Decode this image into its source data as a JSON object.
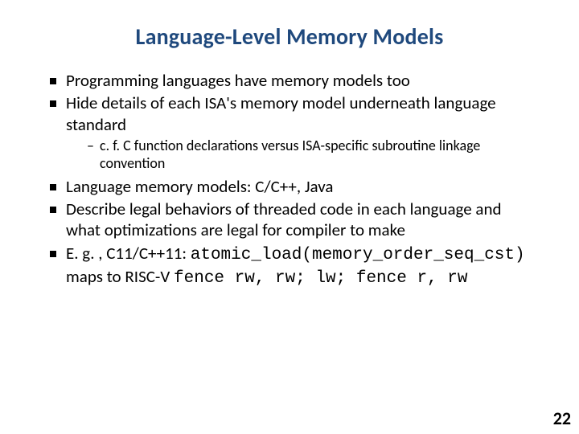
{
  "title": "Language-Level Memory Models",
  "bullets": {
    "b1": "Programming languages have memory models too",
    "b2": "Hide details of each ISA's memory model underneath language standard",
    "b2_sub1": "c. f. C function declarations versus ISA-specific subroutine linkage convention",
    "b3": "Language memory models: C/C++, Java",
    "b4": "Describe legal behaviors of threaded code in each language and what optimizations are legal for compiler to make",
    "b5_lead": "E. g. , C11/C++11:  ",
    "b5_code1": "atomic_load(memory_order_seq_cst)",
    "b5_mid": " maps to RISC-V   ",
    "b5_code2": "fence rw, rw; lw; fence r, rw"
  },
  "page_number": "22"
}
